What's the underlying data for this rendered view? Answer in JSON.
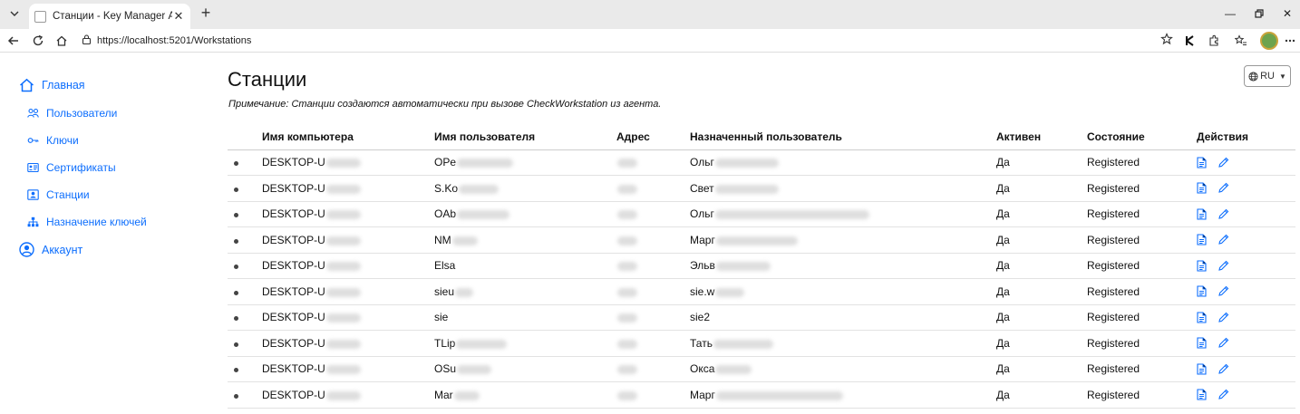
{
  "browser": {
    "tab_title": "Станции - Key Manager Админис",
    "url": "https://localhost:5201/Workstations"
  },
  "sidebar": {
    "items": [
      {
        "label": "Главная",
        "icon": "home-icon"
      },
      {
        "label": "Пользователи",
        "icon": "users-icon"
      },
      {
        "label": "Ключи",
        "icon": "key-icon"
      },
      {
        "label": "Сертификаты",
        "icon": "certificate-icon"
      },
      {
        "label": "Станции",
        "icon": "station-icon"
      },
      {
        "label": "Назначение ключей",
        "icon": "hierarchy-icon"
      },
      {
        "label": "Аккаунт",
        "icon": "account-icon"
      }
    ]
  },
  "main": {
    "title": "Станции",
    "note": "Примечание: Станции создаются автоматически при вызове CheckWorkstation из агента.",
    "lang_label": "RU"
  },
  "table": {
    "headers": [
      "Имя компьютера",
      "Имя пользователя",
      "Адрес",
      "Назначенный пользователь",
      "Активен",
      "Состояние",
      "Действия"
    ],
    "rows": [
      {
        "computer": "DESKTOP-U",
        "user": "OPe",
        "assigned": "Ольг",
        "active": "Да",
        "state": "Registered"
      },
      {
        "computer": "DESKTOP-U",
        "user": "S.Ko",
        "assigned": "Свет",
        "active": "Да",
        "state": "Registered"
      },
      {
        "computer": "DESKTOP-U",
        "user": "OAb",
        "assigned": "Ольг",
        "active": "Да",
        "state": "Registered"
      },
      {
        "computer": "DESKTOP-U",
        "user": "NM",
        "assigned": "Марг",
        "active": "Да",
        "state": "Registered"
      },
      {
        "computer": "DESKTOP-U",
        "user": "Elsa",
        "assigned": "Эльв",
        "active": "Да",
        "state": "Registered"
      },
      {
        "computer": "DESKTOP-U",
        "user": "sieu",
        "assigned": "sie.w",
        "active": "Да",
        "state": "Registered"
      },
      {
        "computer": "DESKTOP-U",
        "user": "sie",
        "assigned": "sie2",
        "active": "Да",
        "state": "Registered"
      },
      {
        "computer": "DESKTOP-U",
        "user": "TLip",
        "assigned": "Тать",
        "active": "Да",
        "state": "Registered"
      },
      {
        "computer": "DESKTOP-U",
        "user": "OSu",
        "assigned": "Окса",
        "active": "Да",
        "state": "Registered"
      },
      {
        "computer": "DESKTOP-U",
        "user": "Mar",
        "assigned": "Марг",
        "active": "Да",
        "state": "Registered"
      }
    ]
  },
  "colors": {
    "accent": "#0d6efd"
  }
}
